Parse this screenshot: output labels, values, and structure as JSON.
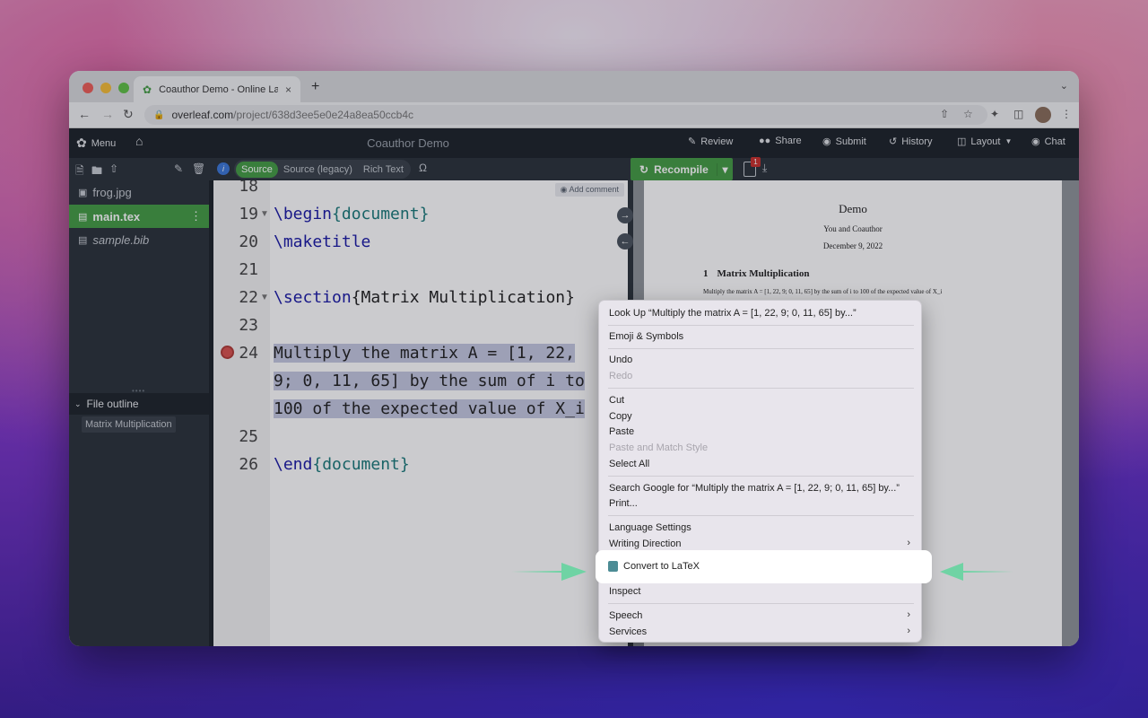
{
  "browser": {
    "tab_title": "Coauthor Demo - Online LaTeX",
    "url_host": "overleaf.com",
    "url_path": "/project/638d3ee5e0e24a8ea50ccb4c"
  },
  "header": {
    "menu_label": "Menu",
    "project_title": "Coauthor Demo",
    "review_label": "Review",
    "share_label": "Share",
    "submit_label": "Submit",
    "history_label": "History",
    "layout_label": "Layout",
    "chat_label": "Chat"
  },
  "editor_toolbar": {
    "info": "i",
    "modes": [
      "Source",
      "Source (legacy)",
      "Rich Text"
    ],
    "omega": "Ω",
    "recompile_label": "Recompile",
    "log_badge": "1"
  },
  "files": [
    {
      "name": "frog.jpg"
    },
    {
      "name": "main.tex"
    },
    {
      "name": "sample.bib"
    }
  ],
  "outline": {
    "heading": "File outline",
    "items": [
      "Matrix Multiplication"
    ]
  },
  "editor": {
    "add_comment": "Add comment",
    "line_numbers": [
      "18",
      "19",
      "20",
      "21",
      "22",
      "23",
      "24",
      "",
      "",
      "25",
      "26"
    ],
    "lines": {
      "l19_cmd": "\\begin",
      "l19_arg": "{document}",
      "l20": "\\maketitle",
      "l22_cmd": "\\section",
      "l22_rest": "{Matrix Multiplication}",
      "l24_a": "Multiply the matrix A = [1, 22,",
      "l24_b": "9; 0, 11, 65] by the sum of i to",
      "l24_c": "100 of the expected value of X_i",
      "l26_cmd": "\\end",
      "l26_arg": "{document}"
    }
  },
  "pdf": {
    "title": "Demo",
    "author": "You and Coauthor",
    "date": "December 9, 2022",
    "section_number": "1",
    "section_title": "Matrix Multiplication",
    "body": "Multiply the matrix A = [1, 22, 9; 0, 11, 65] by the sum of i to 100 of the expected value of X_i"
  },
  "context_menu": {
    "look_up": "Look Up “Multiply the matrix A = [1, 22, 9; 0, 11, 65] by...”",
    "emoji": "Emoji & Symbols",
    "undo": "Undo",
    "redo": "Redo",
    "cut": "Cut",
    "copy": "Copy",
    "paste": "Paste",
    "paste_match": "Paste and Match Style",
    "select_all": "Select All",
    "search_google": "Search Google for “Multiply the matrix A = [1, 22, 9; 0, 11, 65] by...”",
    "print": "Print...",
    "language_settings": "Language Settings",
    "writing_direction": "Writing Direction",
    "convert": "Convert to LaTeX",
    "inspect": "Inspect",
    "speech": "Speech",
    "services": "Services"
  },
  "colors": {
    "overleaf_green": "#449d44",
    "header_bg": "#1d2329",
    "arrow_green": "#6fd3a4"
  }
}
